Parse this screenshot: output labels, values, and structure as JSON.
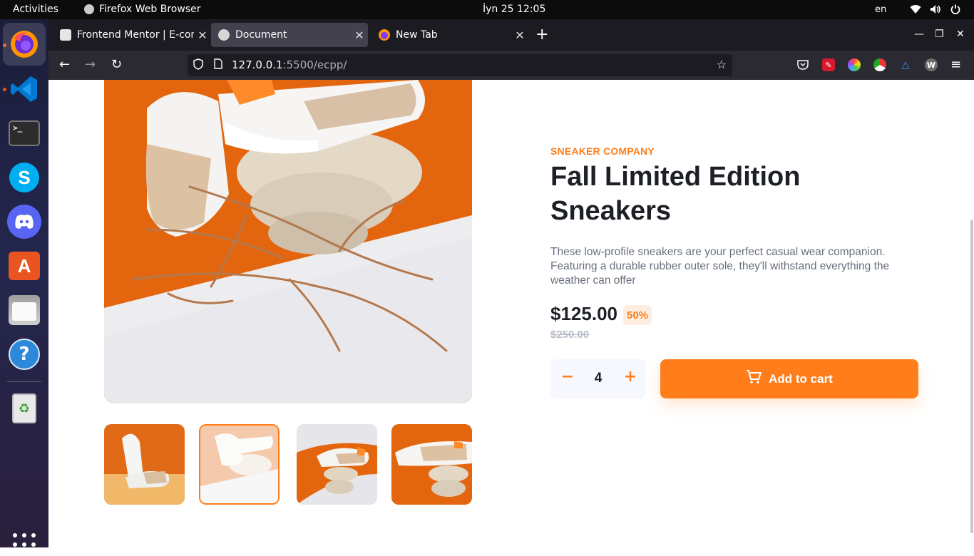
{
  "topbar": {
    "activities": "Activities",
    "app_name": "Firefox Web Browser",
    "clock": "İyn 25  12:05",
    "lang": "en"
  },
  "dock": {
    "items": [
      "firefox",
      "vscode",
      "terminal",
      "skype",
      "discord",
      "app-center",
      "files",
      "help",
      "trash"
    ]
  },
  "browser": {
    "tabs": [
      {
        "label": "Frontend Mentor | E-commerce product page"
      },
      {
        "label": "Document"
      },
      {
        "label": "New Tab"
      }
    ],
    "url_host": "127.0.0.1",
    "url_rest": ":5500/ecpp/"
  },
  "product": {
    "company": "SNEAKER COMPANY",
    "title": "Fall Limited Edition Sneakers",
    "description": "These low-profile sneakers are your perfect casual wear companion. Featuring a durable rubber outer sole, they'll withstand everything the weather can offer",
    "price": "$125.00",
    "discount": "50%",
    "old_price": "$250.00",
    "quantity": "4",
    "add_to_cart": "Add to cart",
    "active_thumbnail": 2
  },
  "colors": {
    "accent": "#ff7e1b",
    "accent_pale": "#ffede0",
    "dark_text": "#1d2026",
    "muted_text": "#68707d"
  }
}
